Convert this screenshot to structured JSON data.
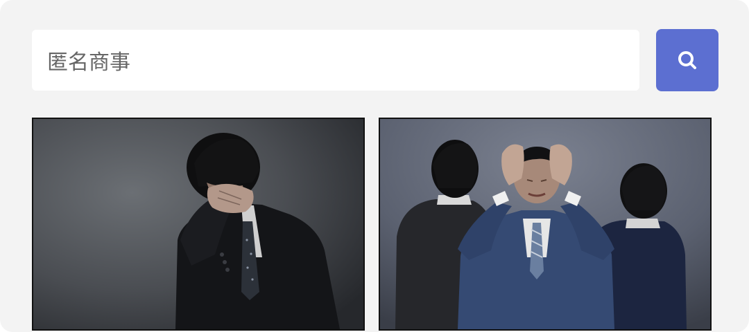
{
  "search": {
    "value": "匿名商事",
    "placeholder": "",
    "button_icon": "search-icon",
    "accent_color": "#5c6fd1"
  },
  "results": [
    {
      "icon": "photo-distressed-businessman"
    },
    {
      "icon": "photo-businessman-holding-head-with-colleagues"
    }
  ]
}
